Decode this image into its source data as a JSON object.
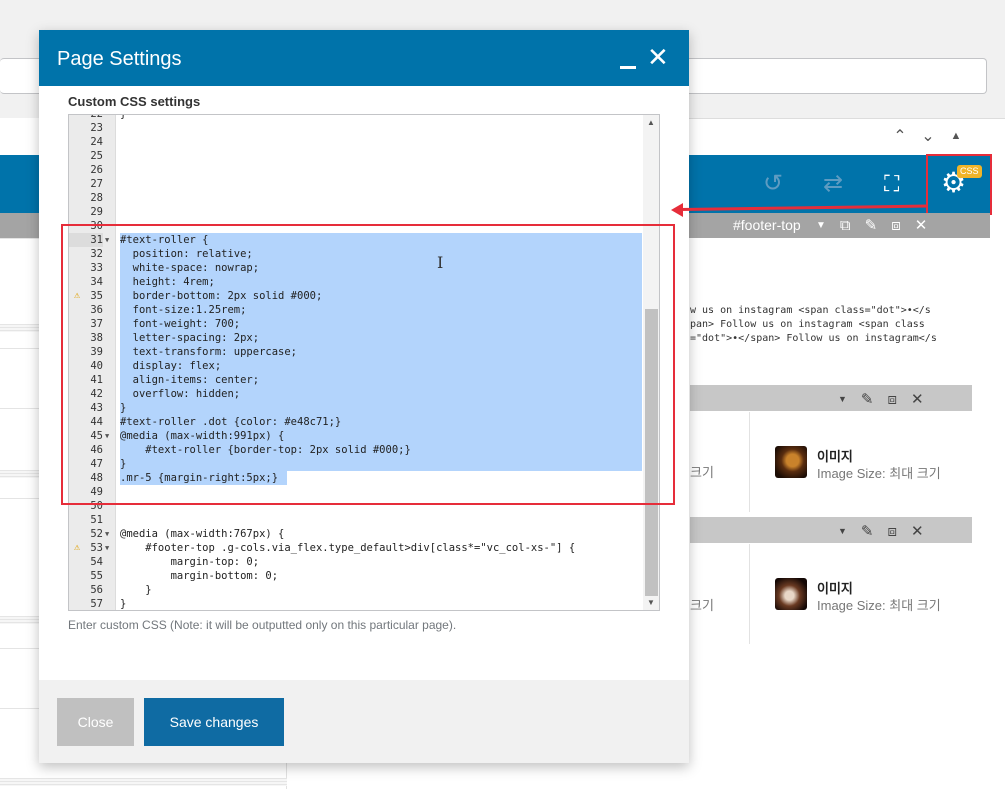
{
  "modal": {
    "title": "Page Settings",
    "section_label": "Custom CSS settings",
    "help_text": "Enter custom CSS (Note: it will be outputted only on this particular page).",
    "close_button": "Close",
    "save_button": "Save changes"
  },
  "editor": {
    "lines": [
      {
        "n": "22",
        "code": "}",
        "sel": false
      },
      {
        "n": "23",
        "code": "",
        "sel": false
      },
      {
        "n": "24",
        "code": "",
        "sel": false
      },
      {
        "n": "25",
        "code": "",
        "sel": false
      },
      {
        "n": "26",
        "code": "",
        "sel": false
      },
      {
        "n": "27",
        "code": "",
        "sel": false
      },
      {
        "n": "28",
        "code": "",
        "sel": false
      },
      {
        "n": "29",
        "code": "",
        "sel": false
      },
      {
        "n": "30",
        "code": "",
        "sel": false
      },
      {
        "n": "31",
        "code": "#text-roller {",
        "sel": true,
        "fold": true
      },
      {
        "n": "32",
        "code": "  position: relative;",
        "sel": true
      },
      {
        "n": "33",
        "code": "  white-space: nowrap;",
        "sel": true
      },
      {
        "n": "34",
        "code": "  height: 4rem;",
        "sel": true
      },
      {
        "n": "35",
        "code": "  border-bottom: 2px solid #000;",
        "sel": true,
        "warn": true
      },
      {
        "n": "36",
        "code": "  font-size:1.25rem;",
        "sel": true
      },
      {
        "n": "37",
        "code": "  font-weight: 700;",
        "sel": true
      },
      {
        "n": "38",
        "code": "  letter-spacing: 2px;",
        "sel": true
      },
      {
        "n": "39",
        "code": "  text-transform: uppercase;",
        "sel": true
      },
      {
        "n": "40",
        "code": "  display: flex;",
        "sel": true
      },
      {
        "n": "41",
        "code": "  align-items: center;",
        "sel": true
      },
      {
        "n": "42",
        "code": "  overflow: hidden;",
        "sel": true
      },
      {
        "n": "43",
        "code": "}",
        "sel": true
      },
      {
        "n": "44",
        "code": "#text-roller .dot {color: #e48c71;}",
        "sel": true
      },
      {
        "n": "45",
        "code": "@media (max-width:991px) {",
        "sel": true,
        "fold": true
      },
      {
        "n": "46",
        "code": "    #text-roller {border-top: 2px solid #000;}",
        "sel": true
      },
      {
        "n": "47",
        "code": "}",
        "sel": true
      },
      {
        "n": "48",
        "code": ".mr-5 {margin-right:5px;}",
        "sel": true,
        "partial": true
      },
      {
        "n": "49",
        "code": "",
        "sel": false
      },
      {
        "n": "50",
        "code": "",
        "sel": false
      },
      {
        "n": "51",
        "code": "",
        "sel": false
      },
      {
        "n": "52",
        "code": "@media (max-width:767px) {",
        "sel": false,
        "fold": true
      },
      {
        "n": "53",
        "code": "    #footer-top .g-cols.via_flex.type_default>div[class*=\"vc_col-xs-\"] {",
        "sel": false,
        "fold": true,
        "warn": true
      },
      {
        "n": "54",
        "code": "        margin-top: 0;",
        "sel": false
      },
      {
        "n": "55",
        "code": "        margin-bottom: 0;",
        "sel": false
      },
      {
        "n": "56",
        "code": "    }",
        "sel": false
      },
      {
        "n": "57",
        "code": "}",
        "sel": false
      }
    ]
  },
  "builder": {
    "css_badge": "CSS",
    "footer_top_label": "#footer-top",
    "code_preview": "w us on instagram <span class=\"dot\">•</s\npan> Follow us on instagram <span class\n=\"dot\">•</span> Follow us on instagram</s",
    "image_cards": [
      {
        "left_text": "크기",
        "title": "이미지",
        "subtitle": "Image Size: 최대 크기"
      },
      {
        "left_text": "크기",
        "title": "이미지",
        "subtitle": "Image Size: 최대 크기"
      }
    ]
  }
}
